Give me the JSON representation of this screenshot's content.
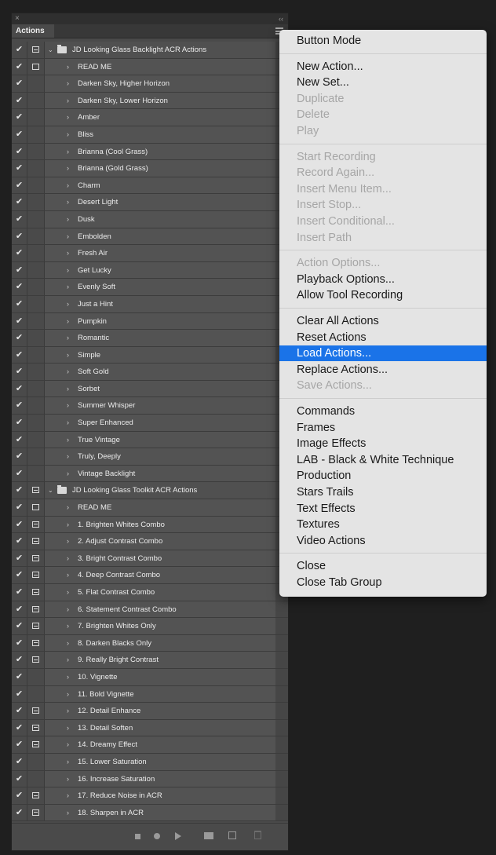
{
  "panel": {
    "close_glyph": "×",
    "collapse_glyph": "‹‹",
    "tab_label": "Actions",
    "check_glyph": "✔",
    "rows": [
      {
        "type": "set",
        "label": "JD Looking Glass Backlight ACR Actions",
        "dialog": "on"
      },
      {
        "type": "action",
        "label": "READ ME",
        "dialog": "empty"
      },
      {
        "type": "action",
        "label": "Darken Sky, Higher Horizon",
        "dialog": "none"
      },
      {
        "type": "action",
        "label": "Darken Sky, Lower Horizon",
        "dialog": "none"
      },
      {
        "type": "action",
        "label": "Amber",
        "dialog": "none"
      },
      {
        "type": "action",
        "label": "Bliss",
        "dialog": "none"
      },
      {
        "type": "action",
        "label": "Brianna (Cool Grass)",
        "dialog": "none"
      },
      {
        "type": "action",
        "label": "Brianna (Gold Grass)",
        "dialog": "none"
      },
      {
        "type": "action",
        "label": "Charm",
        "dialog": "none"
      },
      {
        "type": "action",
        "label": "Desert Light",
        "dialog": "none"
      },
      {
        "type": "action",
        "label": "Dusk",
        "dialog": "none"
      },
      {
        "type": "action",
        "label": "Embolden",
        "dialog": "none"
      },
      {
        "type": "action",
        "label": "Fresh Air",
        "dialog": "none"
      },
      {
        "type": "action",
        "label": "Get Lucky",
        "dialog": "none"
      },
      {
        "type": "action",
        "label": "Evenly Soft",
        "dialog": "none"
      },
      {
        "type": "action",
        "label": "Just a Hint",
        "dialog": "none"
      },
      {
        "type": "action",
        "label": "Pumpkin",
        "dialog": "none"
      },
      {
        "type": "action",
        "label": "Romantic",
        "dialog": "none"
      },
      {
        "type": "action",
        "label": "Simple",
        "dialog": "none"
      },
      {
        "type": "action",
        "label": "Soft Gold",
        "dialog": "none"
      },
      {
        "type": "action",
        "label": "Sorbet",
        "dialog": "none"
      },
      {
        "type": "action",
        "label": "Summer Whisper",
        "dialog": "none"
      },
      {
        "type": "action",
        "label": "Super Enhanced",
        "dialog": "none"
      },
      {
        "type": "action",
        "label": "True Vintage",
        "dialog": "none"
      },
      {
        "type": "action",
        "label": "Truly, Deeply",
        "dialog": "none"
      },
      {
        "type": "action",
        "label": "Vintage Backlight",
        "dialog": "none"
      },
      {
        "type": "set",
        "label": "JD Looking Glass Toolkit ACR Actions",
        "dialog": "on"
      },
      {
        "type": "action",
        "label": "READ ME",
        "dialog": "empty"
      },
      {
        "type": "action",
        "label": "1. Brighten Whites Combo",
        "dialog": "on"
      },
      {
        "type": "action",
        "label": "2. Adjust Contrast Combo",
        "dialog": "on"
      },
      {
        "type": "action",
        "label": "3. Bright Contrast Combo",
        "dialog": "on"
      },
      {
        "type": "action",
        "label": "4. Deep Contrast Combo",
        "dialog": "on"
      },
      {
        "type": "action",
        "label": "5. Flat Contrast Combo",
        "dialog": "on"
      },
      {
        "type": "action",
        "label": "6. Statement Contrast Combo",
        "dialog": "on"
      },
      {
        "type": "action",
        "label": "7. Brighten Whites Only",
        "dialog": "on"
      },
      {
        "type": "action",
        "label": "8. Darken Blacks Only",
        "dialog": "on"
      },
      {
        "type": "action",
        "label": "9. Really Bright Contrast",
        "dialog": "on"
      },
      {
        "type": "action",
        "label": "10. Vignette",
        "dialog": "none"
      },
      {
        "type": "action",
        "label": "11. Bold Vignette",
        "dialog": "none"
      },
      {
        "type": "action",
        "label": "12. Detail Enhance",
        "dialog": "on"
      },
      {
        "type": "action",
        "label": "13. Detail Soften",
        "dialog": "on"
      },
      {
        "type": "action",
        "label": "14. Dreamy Effect",
        "dialog": "on"
      },
      {
        "type": "action",
        "label": "15. Lower Saturation",
        "dialog": "none"
      },
      {
        "type": "action",
        "label": "16. Increase Saturation",
        "dialog": "none"
      },
      {
        "type": "action",
        "label": "17. Reduce Noise in ACR",
        "dialog": "on"
      },
      {
        "type": "action",
        "label": "18. Sharpen in ACR",
        "dialog": "on"
      }
    ]
  },
  "menu": {
    "highlight_color": "#1a73e8",
    "groups": [
      [
        {
          "label": "Button Mode",
          "enabled": true
        }
      ],
      [
        {
          "label": "New Action...",
          "enabled": true
        },
        {
          "label": "New Set...",
          "enabled": true
        },
        {
          "label": "Duplicate",
          "enabled": false
        },
        {
          "label": "Delete",
          "enabled": false
        },
        {
          "label": "Play",
          "enabled": false
        }
      ],
      [
        {
          "label": "Start Recording",
          "enabled": false
        },
        {
          "label": "Record Again...",
          "enabled": false
        },
        {
          "label": "Insert Menu Item...",
          "enabled": false
        },
        {
          "label": "Insert Stop...",
          "enabled": false
        },
        {
          "label": "Insert Conditional...",
          "enabled": false
        },
        {
          "label": "Insert Path",
          "enabled": false
        }
      ],
      [
        {
          "label": "Action Options...",
          "enabled": false
        },
        {
          "label": "Playback Options...",
          "enabled": true
        },
        {
          "label": "Allow Tool Recording",
          "enabled": true
        }
      ],
      [
        {
          "label": "Clear All Actions",
          "enabled": true
        },
        {
          "label": "Reset Actions",
          "enabled": true
        },
        {
          "label": "Load Actions...",
          "enabled": true,
          "highlighted": true
        },
        {
          "label": "Replace Actions...",
          "enabled": true
        },
        {
          "label": "Save Actions...",
          "enabled": false
        }
      ],
      [
        {
          "label": "Commands",
          "enabled": true
        },
        {
          "label": "Frames",
          "enabled": true
        },
        {
          "label": "Image Effects",
          "enabled": true
        },
        {
          "label": "LAB - Black & White Technique",
          "enabled": true
        },
        {
          "label": "Production",
          "enabled": true
        },
        {
          "label": "Stars Trails",
          "enabled": true
        },
        {
          "label": "Text Effects",
          "enabled": true
        },
        {
          "label": "Textures",
          "enabled": true
        },
        {
          "label": "Video Actions",
          "enabled": true
        }
      ],
      [
        {
          "label": "Close",
          "enabled": true
        },
        {
          "label": "Close Tab Group",
          "enabled": true
        }
      ]
    ]
  }
}
